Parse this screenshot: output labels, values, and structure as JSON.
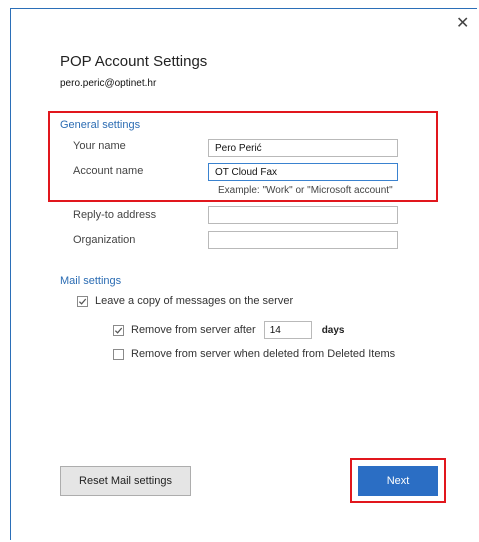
{
  "dialog": {
    "close_glyph": "✕",
    "title": "POP Account Settings",
    "account": "pero.peric@optinet.hr"
  },
  "general": {
    "heading": "General settings",
    "your_name_label": "Your name",
    "your_name_value": "Pero Perić",
    "account_name_label": "Account name",
    "account_name_value": "OT Cloud Fax",
    "example_hint": "Example: \"Work\" or \"Microsoft account\"",
    "reply_to_label": "Reply-to address",
    "reply_to_value": "",
    "organization_label": "Organization",
    "organization_value": ""
  },
  "mail": {
    "heading": "Mail settings",
    "leave_copy_label": "Leave a copy of messages on the server",
    "leave_copy_checked": true,
    "remove_after_label": "Remove from server after",
    "remove_after_checked": true,
    "remove_after_days": "14",
    "days_label": "days",
    "remove_deleted_label": "Remove from server when deleted from Deleted Items",
    "remove_deleted_checked": false
  },
  "buttons": {
    "reset_label": "Reset Mail settings",
    "next_label": "Next"
  },
  "colors": {
    "accent": "#2b6ec4",
    "highlight": "#e1171d",
    "heading": "#2b6cb3"
  }
}
